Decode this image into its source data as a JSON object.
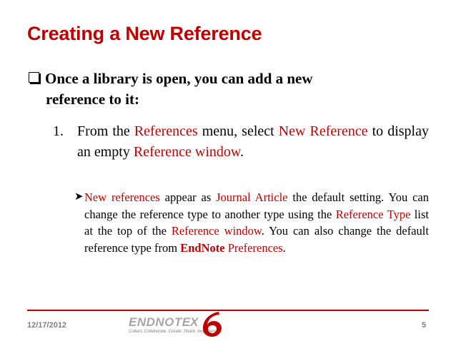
{
  "slide": {
    "title": "Creating a New Reference",
    "main_bullet": {
      "line1": "Once a library is open, you can add a new",
      "line2": "reference to it:"
    },
    "step1": {
      "number": "1.",
      "t1": "From the ",
      "t2": "References",
      "t3": " menu, select ",
      "t4": "New Reference",
      "t5": " to display an empty ",
      "t6": "Reference window",
      "t7": "."
    },
    "sub_bullet": {
      "arrow": "➤",
      "t1": "New references",
      "t2": " appear as ",
      "t3": "Journal Article",
      "t4": " the default setting. You can change the reference type to another type using the ",
      "t5": "Reference Type",
      "t6": " list at the top of the ",
      "t7": "Reference window",
      "t8": ". You can also change the default reference type from ",
      "t9": "EndNote",
      "t10": " ",
      "t11": "Preferences",
      "t12": "."
    },
    "footer": {
      "date": "12/17/2012",
      "page": "5",
      "logo_text": "ENDNOTE",
      "logo_x": "X",
      "logo_six": "6",
      "logo_tagline": "Collect. Collaborate. Create. Share. Anywhere."
    }
  },
  "colors": {
    "accent": "#c00000",
    "muted": "#7f7f7f"
  }
}
